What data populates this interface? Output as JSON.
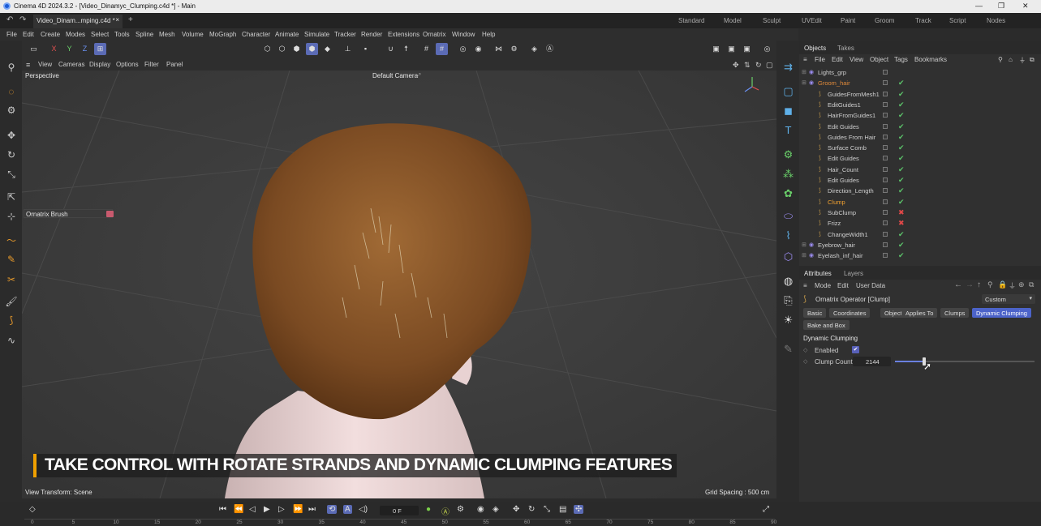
{
  "window": {
    "title": "Cinema 4D 2024.3.2 - [Video_Dinamyc_Clumping.c4d *] - Main",
    "tab_label": "Video_Dinam...mping.c4d *",
    "tab_close": "×",
    "tab_add": "+",
    "layouts": [
      "Standard",
      "Model",
      "Sculpt",
      "UVEdit",
      "Paint",
      "Groom",
      "Track",
      "Script",
      "Nodes"
    ],
    "controls": [
      "—",
      "❐",
      "✕"
    ]
  },
  "menu": [
    "File",
    "Edit",
    "Create",
    "Modes",
    "Select",
    "Tools",
    "Spline",
    "Mesh",
    "Volume",
    "MoGraph",
    "Character",
    "Animate",
    "Simulate",
    "Tracker",
    "Render",
    "Extensions",
    "Ornatrix",
    "Window",
    "Help"
  ],
  "axis_buttons": [
    "X",
    "Y",
    "Z"
  ],
  "viewport": {
    "menu": [
      "View",
      "Cameras",
      "Display",
      "Options",
      "Filter",
      "Panel"
    ],
    "projection": "Perspective",
    "camera": "Default Camera",
    "camera_icon": "•°",
    "overlay_label": "Ornatrix Brush",
    "view_transform": "View Transform: Scene",
    "grid_spacing": "Grid Spacing : 500 cm",
    "caption": "TAKE CONTROL WITH ROTATE STRANDS AND DYNAMIC CLUMPING FEATURES"
  },
  "objects": {
    "tabs": [
      "Objects",
      "Takes"
    ],
    "menu": [
      "File",
      "Edit",
      "View",
      "Object",
      "Tags",
      "Bookmarks"
    ],
    "rows": [
      {
        "name": "Lights_grp",
        "level": 0,
        "check": "",
        "color": "#d0d0d0"
      },
      {
        "name": "Groom_hair",
        "level": 0,
        "check": "✔",
        "color": "#e08a3a"
      },
      {
        "name": "GuidesFromMesh1",
        "level": 1,
        "check": "✔",
        "color": "#d0d0d0"
      },
      {
        "name": "EditGuides1",
        "level": 1,
        "check": "✔",
        "color": "#d0d0d0"
      },
      {
        "name": "HairFromGuides1",
        "level": 1,
        "check": "✔",
        "color": "#d0d0d0"
      },
      {
        "name": "Edit Guides",
        "level": 1,
        "check": "✔",
        "color": "#d0d0d0"
      },
      {
        "name": "Guides From Hair",
        "level": 1,
        "check": "✔",
        "color": "#d0d0d0"
      },
      {
        "name": "Surface Comb",
        "level": 1,
        "check": "✔",
        "color": "#d0d0d0"
      },
      {
        "name": "Edit Guides",
        "level": 1,
        "check": "✔",
        "color": "#d0d0d0"
      },
      {
        "name": "Hair_Count",
        "level": 1,
        "check": "✔",
        "color": "#d0d0d0"
      },
      {
        "name": "Edit Guides",
        "level": 1,
        "check": "✔",
        "color": "#d0d0d0"
      },
      {
        "name": "Direction_Length",
        "level": 1,
        "check": "✔",
        "color": "#d0d0d0"
      },
      {
        "name": "Clump",
        "level": 1,
        "check": "✔",
        "color": "#f0a030"
      },
      {
        "name": "SubClump",
        "level": 1,
        "check": "✖",
        "color": "#d0d0d0"
      },
      {
        "name": "Frizz",
        "level": 1,
        "check": "✖",
        "color": "#d0d0d0"
      },
      {
        "name": "ChangeWidth1",
        "level": 1,
        "check": "✔",
        "color": "#d0d0d0"
      },
      {
        "name": "Eyebrow_hair",
        "level": 0,
        "check": "✔",
        "color": "#d0d0d0"
      },
      {
        "name": "Eyelash_inf_hair",
        "level": 0,
        "check": "✔",
        "color": "#d0d0d0"
      }
    ]
  },
  "attributes": {
    "tabs": [
      "Attributes",
      "Layers"
    ],
    "menu": [
      "Mode",
      "Edit",
      "User Data"
    ],
    "object_name": "Ornatrix Operator [Clump]",
    "preset": "Custom",
    "tab_buttons": [
      "Basic",
      "Coordinates",
      "Object",
      "Applies To",
      "Clumps",
      "Dynamic Clumping"
    ],
    "tab_buttons_row2": [
      "Bake and Box"
    ],
    "section_title": "Dynamic Clumping",
    "enabled_label": "Enabled",
    "enabled_check": "✔",
    "clump_count_label": "Clump Count",
    "clump_count_value": "2144",
    "clump_slider_fraction": 0.21
  },
  "timeline": {
    "frame": "0 F",
    "ticks": [
      "0",
      "5",
      "10",
      "15",
      "20",
      "25",
      "30",
      "35",
      "40",
      "45",
      "50",
      "55",
      "60",
      "65",
      "70",
      "75",
      "80",
      "85",
      "90"
    ]
  },
  "colors": {
    "accent": "#4c63c9",
    "check_green": "#5cc46a",
    "check_red": "#e04848",
    "hair": "#7a4a22",
    "skin": "#eed8d8"
  }
}
